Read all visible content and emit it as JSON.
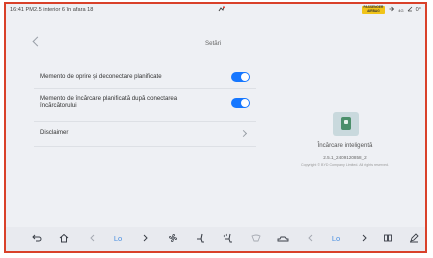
{
  "status_bar": {
    "left_text": "16:41  PM2.5 interior 6  în afara 18",
    "airbag_line1": "PASSENGER",
    "airbag_line2": "AIRBAG",
    "signal": "4G",
    "temperature": "0°"
  },
  "header": {
    "title": "Setări"
  },
  "settings": [
    {
      "label": "Memento de oprire și deconectare planificate",
      "type": "toggle",
      "enabled": true
    },
    {
      "label_line1": "Memento de încărcare planificată după conectarea",
      "label_line2": "încărcătorului",
      "type": "toggle",
      "enabled": true
    },
    {
      "label": "Disclaimer",
      "type": "link"
    }
  ],
  "app_info": {
    "name": "Încărcare inteligentă",
    "version": "2.5.1_2409120858_2",
    "copyright": "Copyright © BYD Company Limited. All rights reserved."
  },
  "nav_bar": {
    "left_temp": "Lo",
    "right_temp": "Lo",
    "accent_color": "#4a90e2"
  },
  "colors": {
    "frame_border": "#d9412a",
    "toggle_on": "#1677ff"
  }
}
